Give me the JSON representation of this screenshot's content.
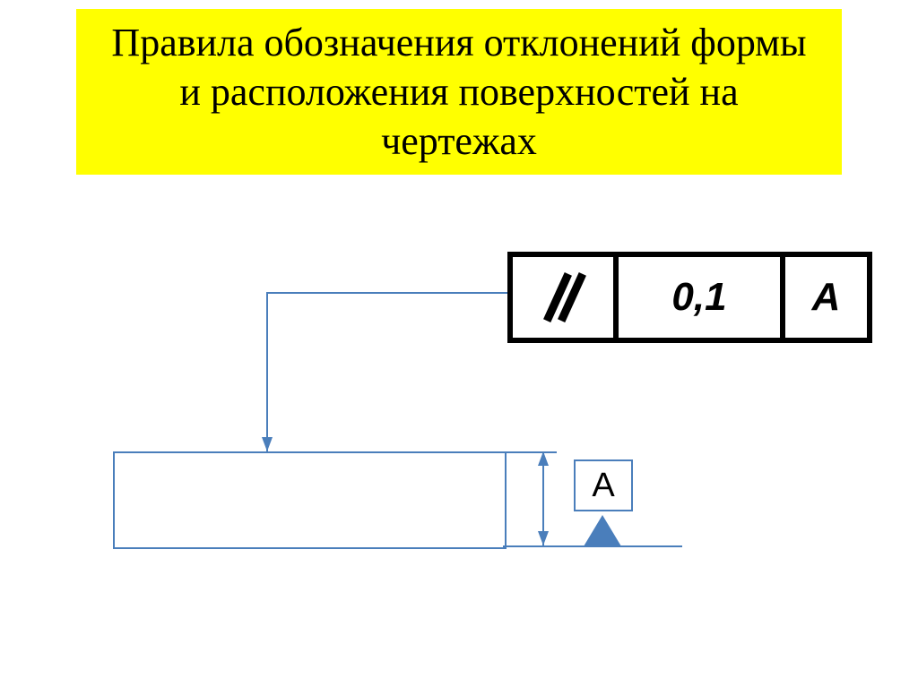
{
  "title": "Правила обозначения отклонений формы и расположения поверхностей на чертежах",
  "tolerance_frame": {
    "symbol_name": "parallelism",
    "value": "0,1",
    "datum": "А"
  },
  "datum_label": "А",
  "colors": {
    "title_bg": "#ffff00",
    "drawing_line": "#4a7ebb",
    "frame_border": "#000000"
  }
}
